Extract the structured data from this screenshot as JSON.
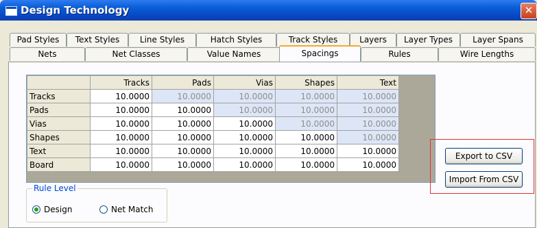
{
  "window": {
    "title": "Design Technology",
    "close_symbol": "✕"
  },
  "tabs": {
    "row1": [
      "Pad Styles",
      "Text Styles",
      "Line Styles",
      "Hatch Styles",
      "Track Styles",
      "Layers",
      "Layer Types",
      "Layer Spans"
    ],
    "row2": [
      "Nets",
      "Net Classes",
      "Value Names",
      "Spacings",
      "Rules",
      "Wire Lengths"
    ],
    "active": "Spacings"
  },
  "grid": {
    "columns": [
      "Tracks",
      "Pads",
      "Vias",
      "Shapes",
      "Text"
    ],
    "rows": [
      {
        "label": "Tracks",
        "values": [
          "10.0000",
          "10.0000",
          "10.0000",
          "10.0000",
          "10.0000"
        ]
      },
      {
        "label": "Pads",
        "values": [
          "10.0000",
          "10.0000",
          "10.0000",
          "10.0000",
          "10.0000"
        ]
      },
      {
        "label": "Vias",
        "values": [
          "10.0000",
          "10.0000",
          "10.0000",
          "10.0000",
          "10.0000"
        ]
      },
      {
        "label": "Shapes",
        "values": [
          "10.0000",
          "10.0000",
          "10.0000",
          "10.0000",
          "10.0000"
        ]
      },
      {
        "label": "Text",
        "values": [
          "10.0000",
          "10.0000",
          "10.0000",
          "10.0000",
          "10.0000"
        ]
      },
      {
        "label": "Board",
        "values": [
          "10.0000",
          "10.0000",
          "10.0000",
          "10.0000",
          "10.0000"
        ]
      }
    ]
  },
  "rule_level": {
    "legend": "Rule Level",
    "options": [
      "Design",
      "Net Match"
    ],
    "selected": "Design"
  },
  "buttons": {
    "export_csv": "Export to CSV",
    "import_csv": "Import From CSV"
  },
  "colors": {
    "title_bar": "#0a5fd8",
    "active_tab_accent": "#f3a92c",
    "dim_cell": "#dde6f6",
    "highlight_box": "#e23030"
  }
}
